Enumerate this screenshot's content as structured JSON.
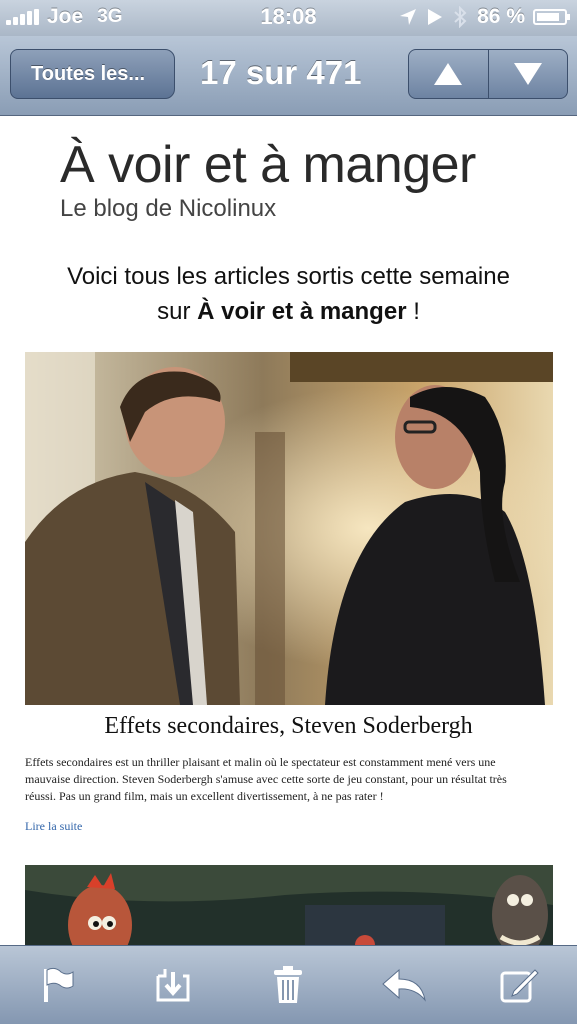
{
  "status_bar": {
    "carrier": "Joe",
    "network": "3G",
    "time": "18:08",
    "battery": "86 %",
    "battery_level": 0.86
  },
  "nav_bar": {
    "back_label": "Toutes les...",
    "position": "17 sur 471"
  },
  "email": {
    "blog_title": "À voir et à manger",
    "blog_subtitle": "Le blog de Nicolinux",
    "intro_line1": "Voici tous les articles sortis cette semaine",
    "intro_prefix": "sur",
    "intro_bold": "À voir et à manger",
    "intro_suffix": "!",
    "article": {
      "title": "Effets secondaires, Steven Soderbergh",
      "body": "Effets secondaires est un thriller plaisant et malin où le spectateur est constamment mené vers une mauvaise direction. Steven Soderbergh s'amuse avec cette sorte de jeu constant, pour un résultat très réussi. Pas un grand film, mais un excellent divertissement, à ne pas rater !",
      "read_more": "Lire la suite"
    }
  },
  "toolbar": {
    "icons": [
      "flag-icon",
      "move-to-folder-icon",
      "trash-icon",
      "reply-icon",
      "compose-icon"
    ]
  },
  "colors": {
    "nav_gradient_top": "#b8c6d7",
    "nav_gradient_bottom": "#8a9db5",
    "link": "#3366aa"
  }
}
